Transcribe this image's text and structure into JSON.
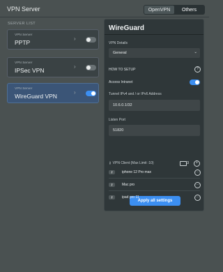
{
  "header": {
    "title": "VPN Server",
    "tabs": [
      "OpenVPN",
      "Others"
    ]
  },
  "server_list": {
    "label": "SERVER LIST",
    "items": [
      {
        "sub": "VPN Server",
        "name": "PPTP",
        "enabled": false
      },
      {
        "sub": "VPN Server",
        "name": "IPSec VPN",
        "enabled": false
      },
      {
        "sub": "VPN Server",
        "name": "WireGuard VPN",
        "enabled": true
      }
    ]
  },
  "panel": {
    "title": "WireGuard",
    "vpn_details_label": "VPN Details",
    "vpn_details_value": "General",
    "how_to_setup": "HOW TO SETUP",
    "access_intranet": "Access Intranet",
    "access_intranet_enabled": true,
    "tunnel_label": "Tunnel IPv4 and / or IPv6 Address",
    "tunnel_value": "10.6.0.1/32",
    "listen_port_label": "Listen Port",
    "listen_port_value": "51820",
    "vpn_client_label": "VPN Client (Max Limit :10)",
    "client_count": "3",
    "clients": [
      "iphone 12 Pro max",
      "Mac pro",
      "ipad pro 11"
    ],
    "apply_label": "Apply all settings"
  },
  "colors": {
    "accent": "#3c8ff2",
    "selected_card": "#3b5577"
  }
}
